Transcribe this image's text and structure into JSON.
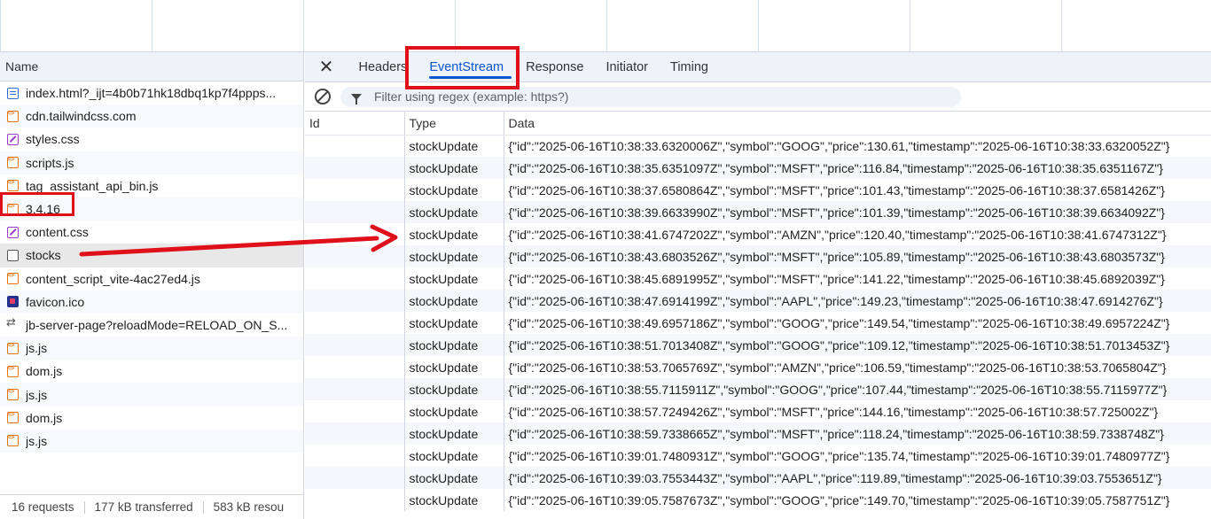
{
  "left": {
    "header": "Name",
    "files": [
      {
        "name": "index.html?_ijt=4b0b71hk18dbq1kp7f4ppps...",
        "icon": "document-icon"
      },
      {
        "name": "cdn.tailwindcss.com",
        "icon": "script-icon"
      },
      {
        "name": "styles.css",
        "icon": "stylesheet-icon"
      },
      {
        "name": "scripts.js",
        "icon": "script-icon"
      },
      {
        "name": "tag_assistant_api_bin.js",
        "icon": "script-icon"
      },
      {
        "name": "3.4.16",
        "icon": "script-icon"
      },
      {
        "name": "content.css",
        "icon": "stylesheet-icon"
      },
      {
        "name": "stocks",
        "icon": "plain-file-icon"
      },
      {
        "name": "content_script_vite-4ac27ed4.js",
        "icon": "script-icon"
      },
      {
        "name": "favicon.ico",
        "icon": "favicon-icon"
      },
      {
        "name": "jb-server-page?reloadMode=RELOAD_ON_S...",
        "icon": "fetch-icon"
      },
      {
        "name": "js.js",
        "icon": "script-icon"
      },
      {
        "name": "dom.js",
        "icon": "script-icon"
      },
      {
        "name": "js.js",
        "icon": "script-icon"
      },
      {
        "name": "dom.js",
        "icon": "script-icon"
      },
      {
        "name": "js.js",
        "icon": "script-icon"
      }
    ],
    "status": {
      "requests": "16 requests",
      "transferred": "177 kB transferred",
      "resources": "583 kB resou"
    }
  },
  "right": {
    "tabs": [
      {
        "label": "Headers",
        "active": false
      },
      {
        "label": "EventStream",
        "active": true
      },
      {
        "label": "Response",
        "active": false
      },
      {
        "label": "Initiator",
        "active": false
      },
      {
        "label": "Timing",
        "active": false
      }
    ],
    "close_glyph": "✕",
    "filter": {
      "placeholder": "Filter using regex (example: https?)",
      "value": ""
    },
    "columns": {
      "id": "Id",
      "type": "Type",
      "data": "Data"
    },
    "events": [
      {
        "id": "",
        "type": "stockUpdate",
        "data": "{\"id\":\"2025-06-16T10:38:33.6320006Z\",\"symbol\":\"GOOG\",\"price\":130.61,\"timestamp\":\"2025-06-16T10:38:33.6320052Z\"}"
      },
      {
        "id": "",
        "type": "stockUpdate",
        "data": "{\"id\":\"2025-06-16T10:38:35.6351097Z\",\"symbol\":\"MSFT\",\"price\":116.84,\"timestamp\":\"2025-06-16T10:38:35.6351167Z\"}"
      },
      {
        "id": "",
        "type": "stockUpdate",
        "data": "{\"id\":\"2025-06-16T10:38:37.6580864Z\",\"symbol\":\"MSFT\",\"price\":101.43,\"timestamp\":\"2025-06-16T10:38:37.6581426Z\"}"
      },
      {
        "id": "",
        "type": "stockUpdate",
        "data": "{\"id\":\"2025-06-16T10:38:39.6633990Z\",\"symbol\":\"MSFT\",\"price\":101.39,\"timestamp\":\"2025-06-16T10:38:39.6634092Z\"}"
      },
      {
        "id": "",
        "type": "stockUpdate",
        "data": "{\"id\":\"2025-06-16T10:38:41.6747202Z\",\"symbol\":\"AMZN\",\"price\":120.40,\"timestamp\":\"2025-06-16T10:38:41.6747312Z\"}"
      },
      {
        "id": "",
        "type": "stockUpdate",
        "data": "{\"id\":\"2025-06-16T10:38:43.6803526Z\",\"symbol\":\"MSFT\",\"price\":105.89,\"timestamp\":\"2025-06-16T10:38:43.6803573Z\"}"
      },
      {
        "id": "",
        "type": "stockUpdate",
        "data": "{\"id\":\"2025-06-16T10:38:45.6891995Z\",\"symbol\":\"MSFT\",\"price\":141.22,\"timestamp\":\"2025-06-16T10:38:45.6892039Z\"}"
      },
      {
        "id": "",
        "type": "stockUpdate",
        "data": "{\"id\":\"2025-06-16T10:38:47.6914199Z\",\"symbol\":\"AAPL\",\"price\":149.23,\"timestamp\":\"2025-06-16T10:38:47.6914276Z\"}"
      },
      {
        "id": "",
        "type": "stockUpdate",
        "data": "{\"id\":\"2025-06-16T10:38:49.6957186Z\",\"symbol\":\"GOOG\",\"price\":149.54,\"timestamp\":\"2025-06-16T10:38:49.6957224Z\"}"
      },
      {
        "id": "",
        "type": "stockUpdate",
        "data": "{\"id\":\"2025-06-16T10:38:51.7013408Z\",\"symbol\":\"GOOG\",\"price\":109.12,\"timestamp\":\"2025-06-16T10:38:51.7013453Z\"}"
      },
      {
        "id": "",
        "type": "stockUpdate",
        "data": "{\"id\":\"2025-06-16T10:38:53.7065769Z\",\"symbol\":\"AMZN\",\"price\":106.59,\"timestamp\":\"2025-06-16T10:38:53.7065804Z\"}"
      },
      {
        "id": "",
        "type": "stockUpdate",
        "data": "{\"id\":\"2025-06-16T10:38:55.7115911Z\",\"symbol\":\"GOOG\",\"price\":107.44,\"timestamp\":\"2025-06-16T10:38:55.7115977Z\"}"
      },
      {
        "id": "",
        "type": "stockUpdate",
        "data": "{\"id\":\"2025-06-16T10:38:57.7249426Z\",\"symbol\":\"MSFT\",\"price\":144.16,\"timestamp\":\"2025-06-16T10:38:57.725002Z\"}"
      },
      {
        "id": "",
        "type": "stockUpdate",
        "data": "{\"id\":\"2025-06-16T10:38:59.7338665Z\",\"symbol\":\"MSFT\",\"price\":118.24,\"timestamp\":\"2025-06-16T10:38:59.7338748Z\"}"
      },
      {
        "id": "",
        "type": "stockUpdate",
        "data": "{\"id\":\"2025-06-16T10:39:01.7480931Z\",\"symbol\":\"GOOG\",\"price\":135.74,\"timestamp\":\"2025-06-16T10:39:01.7480977Z\"}"
      },
      {
        "id": "",
        "type": "stockUpdate",
        "data": "{\"id\":\"2025-06-16T10:39:03.7553443Z\",\"symbol\":\"AAPL\",\"price\":119.89,\"timestamp\":\"2025-06-16T10:39:03.7553651Z\"}"
      },
      {
        "id": "",
        "type": "stockUpdate",
        "data": "{\"id\":\"2025-06-16T10:39:05.7587673Z\",\"symbol\":\"GOOG\",\"price\":149.70,\"timestamp\":\"2025-06-16T10:39:05.7587751Z\"}"
      }
    ]
  },
  "annotations": {
    "highlight_color": "#e0101b"
  },
  "colors": {
    "accent": "#0b57d0",
    "header_bg": "#eef2f9"
  }
}
